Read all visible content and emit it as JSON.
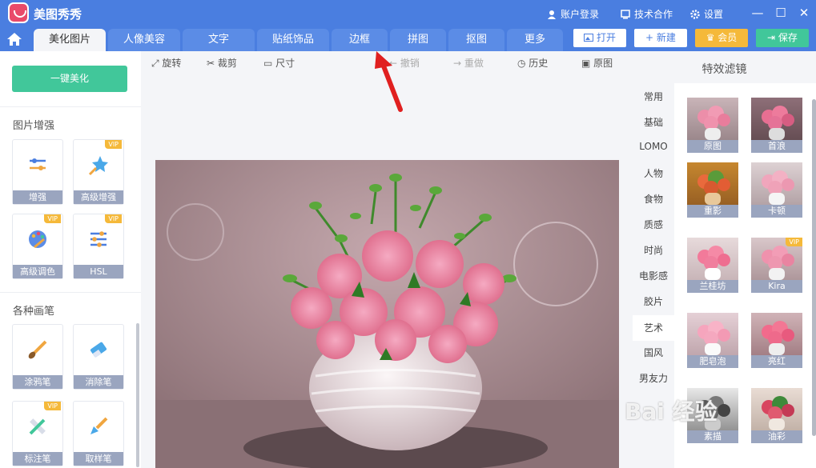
{
  "app": {
    "title": "美图秀秀"
  },
  "titlebar": {
    "login": "账户登录",
    "cooperate": "技术合作",
    "settings": "设置",
    "min": "—",
    "max": "☐",
    "close": "✕"
  },
  "tabs": [
    {
      "label": "美化图片"
    },
    {
      "label": "人像美容"
    },
    {
      "label": "文字"
    },
    {
      "label": "贴纸饰品"
    },
    {
      "label": "边框"
    },
    {
      "label": "拼图"
    },
    {
      "label": "抠图"
    },
    {
      "label": "更多"
    }
  ],
  "actions": {
    "open": "打开",
    "new": "新建",
    "vip": "会员",
    "save": "保存"
  },
  "left": {
    "onekey": "一键美化",
    "enhance_title": "图片增强",
    "brush_title": "各种画笔",
    "vip_badge": "VIP",
    "enhance": [
      {
        "label": "增强"
      },
      {
        "label": "高级增强"
      },
      {
        "label": "高级调色"
      },
      {
        "label": "HSL"
      }
    ],
    "brushes": [
      {
        "label": "涂鸦笔"
      },
      {
        "label": "消除笔"
      },
      {
        "label": "标注笔"
      },
      {
        "label": "取样笔"
      }
    ]
  },
  "tools": {
    "rotate": "旋转",
    "crop": "裁剪",
    "size": "尺寸",
    "undo": "撤销",
    "redo": "重做",
    "history": "历史",
    "original": "原图"
  },
  "filters": {
    "title": "特效滤镜",
    "categories": [
      "常用",
      "基础",
      "LOMO",
      "人物",
      "食物",
      "质感",
      "时尚",
      "电影感",
      "胶片",
      "艺术",
      "国风",
      "男友力"
    ],
    "items": [
      {
        "label": "原图"
      },
      {
        "label": "首浪"
      },
      {
        "label": "重影"
      },
      {
        "label": "卡顿"
      },
      {
        "label": "兰桂坊"
      },
      {
        "label": "Kira"
      },
      {
        "label": "肥皂泡"
      },
      {
        "label": "亮红"
      },
      {
        "label": "素描"
      },
      {
        "label": "油彩"
      }
    ]
  },
  "watermark": "Bai 经验",
  "colors": {
    "accent": "#4a7ee0",
    "green": "#41c79a",
    "vip": "#f5b93a"
  }
}
